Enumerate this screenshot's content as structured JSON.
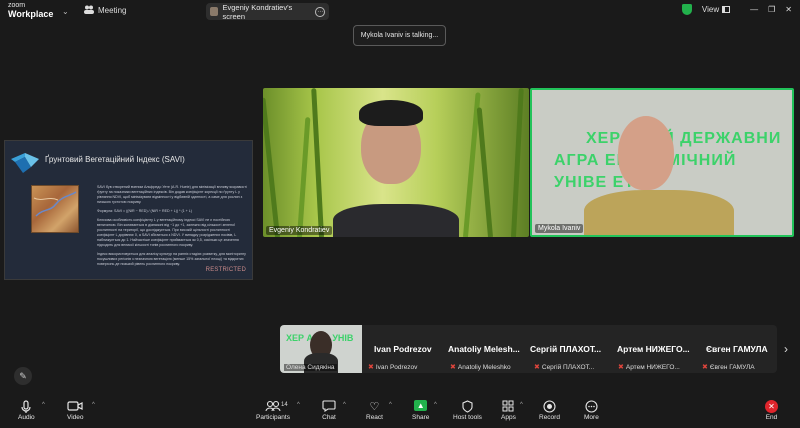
{
  "app": {
    "logo_line1": "zoom",
    "logo_line2": "Workplace"
  },
  "topbar": {
    "meeting_label": "Meeting",
    "share_label": "Evgeniy Kondratiev's screen",
    "view_label": "View"
  },
  "talking_indicator": "Mykola Ivaniv is talking...",
  "slide": {
    "title": "Ґрунтовий Вегетаційний Індекс (SAVI)",
    "paragraphs": [
      "SAVI був створений вченим Альфредо Уете (A.R. Huete) для мінімізації впливу яскравості ґрунту на показники вегетаційних індексів. Він додав коефіцієнт корекції по ґрунту L у рівняння NDVI, щоб мінімізувати відмінності у відбивній здатності, а саме для рослин з низькою густотою покриву.",
      "Формула: SAVI = ((NIR − RED) / (NIR + RED + L)) * (1 + L)",
      "Ключова особливість коефіцієнту L у вегетаційному індексі SAVI не є постійною величиною. Він коливається в діапазоні від −1 до +1, залежно від кількості зеленої рослинності на території, що досліджується. При високій щільності рослинності коефіцієнт L дорівнює 0, а SAVI збігається з NDVI. У випадку розріджених посівів, L наближується до 1. Найчастіше коефіцієнт приймається як 0,5, оскільки це значення підходить для великої кількості типів рослинного покриву.",
      "Індекс використовується для аналізу культур на ранніх стадіях розвитку, для моніторингу посушливих регіонів з незначною вегетацією (менше 15% загальної площі) та відкритих поверхонь де низький рівень рослинного покриву."
    ],
    "restricted_label": "RESTRICTED"
  },
  "tiles": [
    {
      "name": "Evgeniy Kondratiev"
    },
    {
      "name": "Mykola Ivaniv",
      "sign_line1": "ХЕР      ЬКИЙ ДЕРЖАВНИ",
      "sign_line2": "АГРА     ЕКОНОМІЧНИЙ",
      "sign_line3": "УНІВЕ       ЕТ"
    }
  ],
  "filmstrip": {
    "video": {
      "name": "Олена Сидякіна",
      "sign": "ХЕР АГРА УНІВ"
    },
    "participants": [
      {
        "display": "Ivan Podrezov",
        "name": "Ivan Podrezov"
      },
      {
        "display": "Anatoliy Melesh...",
        "name": "Anatoliy Meleshko"
      },
      {
        "display": "Сергій ПЛАХОТ...",
        "name": "Сергій ПЛАХОТ..."
      },
      {
        "display": "Артем НИЖЕГО...",
        "name": "Артем НИЖЕГО..."
      },
      {
        "display": "Євген ГАМУЛА",
        "name": "Євген ГАМУЛА"
      }
    ]
  },
  "toolbar": {
    "audio": "Audio",
    "video": "Video",
    "participants": "Participants",
    "participants_count": "14",
    "chat": "Chat",
    "react": "React",
    "share": "Share",
    "host_tools": "Host tools",
    "apps": "Apps",
    "record": "Record",
    "more": "More",
    "end": "End"
  },
  "colors": {
    "accent_green": "#22b14c",
    "speaker_border": "#22c35a",
    "end_red": "#e0252c",
    "muted_red": "#e0453c"
  }
}
